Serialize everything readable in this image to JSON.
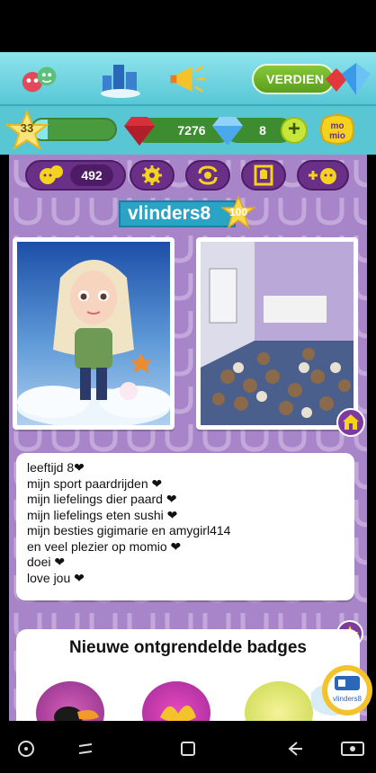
{
  "nav": {
    "earn_label": "VERDIEN"
  },
  "currency": {
    "level": "33",
    "xp_progress": 0.18,
    "rubies": "7276",
    "diamonds": "8",
    "plus": "+"
  },
  "profile": {
    "friends_count": "492",
    "username": "vlinders8",
    "star_level": "100",
    "bio_lines": [
      "leeftijd 8❤",
      "mijn sport paardrijden ❤",
      "mijn liefelings dier paard ❤",
      "mijn liefelings eten sushi ❤",
      "mijn besties gigimarie en amygirl414",
      "en veel plezier op momio ❤",
      "doei ❤",
      "love jou ❤"
    ],
    "badges_title": "Nieuwe ontgrendelde badges",
    "profile_badge_name": "vlinders8"
  },
  "colors": {
    "nav_bg": "#6fd3df",
    "profile_bg": "#a885c8",
    "action_btn": "#6a2f86",
    "earn_btn": "#6fb52b",
    "name_banner": "#2aa3c4"
  },
  "icons": {
    "nav": [
      "friends-icon",
      "city-icon",
      "megaphone-icon"
    ],
    "actions": [
      "add-friend-icon",
      "gear-icon",
      "swap-icon",
      "wardrobe-icon",
      "add-group-icon"
    ],
    "system": [
      "game-icon",
      "recents-icon",
      "home-icon",
      "back-icon",
      "record-icon"
    ]
  }
}
